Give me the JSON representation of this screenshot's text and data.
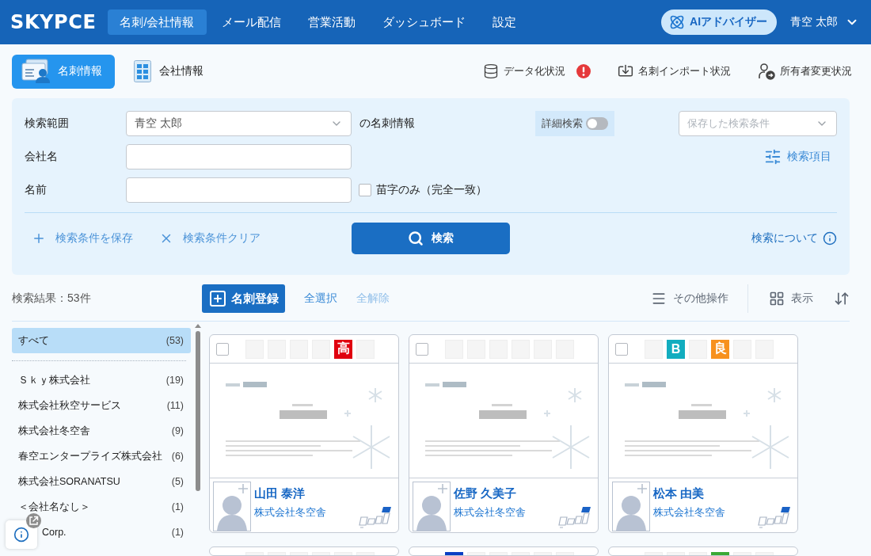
{
  "header": {
    "logo": "SKYPCE",
    "nav": [
      {
        "label": "名刺/会社情報",
        "selected": true
      },
      {
        "label": "メール配信",
        "selected": false
      },
      {
        "label": "営業活動",
        "selected": false
      },
      {
        "label": "ダッシュボード",
        "selected": false
      },
      {
        "label": "設定",
        "selected": false
      }
    ],
    "ai_button": "AIアドバイザー",
    "user": "青空 太郎"
  },
  "subnav": {
    "views": [
      {
        "kind": "card",
        "label": "名刺情報",
        "selected": true
      },
      {
        "kind": "company",
        "label": "会社情報",
        "selected": false
      }
    ],
    "status_links": [
      {
        "kind": "data",
        "label": "データ化状況",
        "alert": true
      },
      {
        "kind": "import",
        "label": "名刺インポート状況",
        "alert": false
      },
      {
        "kind": "owner",
        "label": "所有者変更状況",
        "alert": false
      }
    ]
  },
  "search": {
    "scope": {
      "label": "検索範囲",
      "value": "青空 太郎",
      "suffix": "の名刺情報"
    },
    "detail_toggle": {
      "label": "詳細検索",
      "on": false
    },
    "saved_conditions": {
      "placeholder": "保存した検索条件"
    },
    "fields_link": "検索項目",
    "company": {
      "label": "会社名"
    },
    "name": {
      "label": "名前"
    },
    "surname_only": {
      "label": "苗字のみ（完全一致）",
      "checked": false
    },
    "save_link": "検索条件を保存",
    "clear_link": "検索条件クリア",
    "search_button": "検索",
    "help_link": "検索について"
  },
  "results": {
    "count": "検索結果：53件",
    "register_button": "名刺登録",
    "select_all": {
      "label": "全選択",
      "disabled": false
    },
    "deselect_all": {
      "label": "全解除",
      "disabled": true
    },
    "more_actions": "その他操作",
    "view": "表示"
  },
  "sidebar": {
    "all": {
      "name": "すべて",
      "count": "(53)",
      "selected": true
    },
    "companies": [
      {
        "name": "Ｓｋｙ株式会社",
        "count": "(19)",
        "selected": false,
        "covered": false
      },
      {
        "name": "株式会社秋空サービス",
        "count": "(11)",
        "selected": false,
        "covered": false
      },
      {
        "name": "株式会社冬空舎",
        "count": "(9)",
        "selected": false,
        "covered": false
      },
      {
        "name": "春空エンタープライズ株式会社",
        "count": "(6)",
        "selected": false,
        "covered": false
      },
      {
        "name": "株式会社SORANATSU",
        "count": "(5)",
        "selected": false,
        "covered": false
      },
      {
        "name": "＜会社名なし＞",
        "count": "(1)",
        "selected": false,
        "covered": false
      },
      {
        "name": "Corp.",
        "count": "(1)",
        "selected": false,
        "covered": true
      }
    ]
  },
  "cards": [
    {
      "checked": false,
      "tags": [
        {
          "kind": "empty"
        },
        {
          "kind": "empty"
        },
        {
          "kind": "empty"
        },
        {
          "kind": "empty"
        },
        {
          "kind": "tag",
          "label": "高",
          "color": "#e0000f"
        },
        {
          "kind": "empty"
        }
      ],
      "name": "山田 泰洋",
      "company": "株式会社冬空舎"
    },
    {
      "checked": false,
      "tags": [
        {
          "kind": "empty"
        },
        {
          "kind": "empty"
        },
        {
          "kind": "empty"
        },
        {
          "kind": "empty"
        },
        {
          "kind": "empty"
        },
        {
          "kind": "empty"
        }
      ],
      "name": "佐野 久美子",
      "company": "株式会社冬空舎"
    },
    {
      "checked": false,
      "tags": [
        {
          "kind": "empty"
        },
        {
          "kind": "tag",
          "label": "B",
          "color": "#12adbf"
        },
        {
          "kind": "empty"
        },
        {
          "kind": "tag",
          "label": "良",
          "color": "#f7911e"
        },
        {
          "kind": "empty"
        },
        {
          "kind": "empty"
        }
      ],
      "name": "松本 由美",
      "company": "株式会社冬空舎"
    },
    {
      "tags": [
        {
          "kind": "empty"
        },
        {
          "kind": "empty"
        },
        {
          "kind": "empty"
        },
        {
          "kind": "empty"
        },
        {
          "kind": "empty"
        },
        {
          "kind": "empty"
        }
      ]
    },
    {
      "tags": [
        {
          "kind": "tag",
          "color": "#0a3fc4"
        },
        {
          "kind": "empty"
        },
        {
          "kind": "empty"
        },
        {
          "kind": "empty"
        },
        {
          "kind": "empty"
        },
        {
          "kind": "empty"
        }
      ]
    },
    {
      "tags": [
        {
          "kind": "empty"
        },
        {
          "kind": "empty"
        },
        {
          "kind": "empty"
        },
        {
          "kind": "tag",
          "color": "#3aa935"
        },
        {
          "kind": "empty"
        },
        {
          "kind": "empty"
        }
      ]
    }
  ]
}
